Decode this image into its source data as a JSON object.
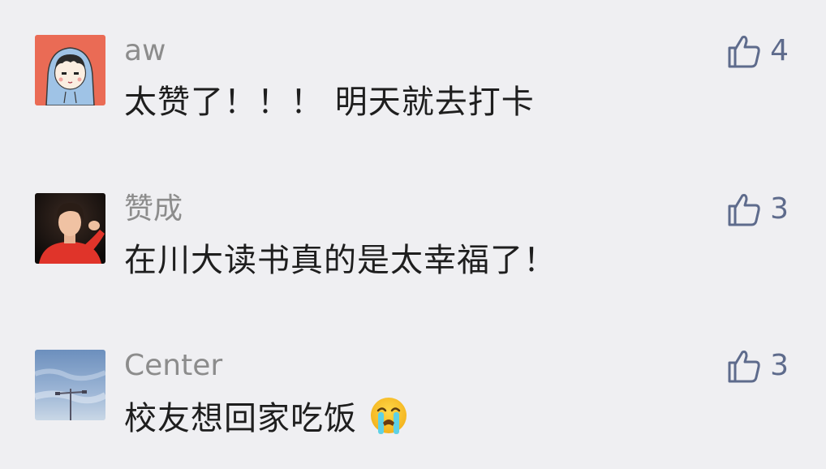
{
  "comments": [
    {
      "user": "aw",
      "text": "太赞了！！！ 明天就去打卡",
      "likes": "4",
      "avatar": "cartoon-boy-hoodie-avatar"
    },
    {
      "user": "赞成",
      "text": "在川大读书真的是太幸福了！",
      "likes": "3",
      "avatar": "person-photo-avatar"
    },
    {
      "user": "Center",
      "text": "校友想回家吃饭",
      "likes": "3",
      "avatar": "sky-streetlight-avatar",
      "emoji": "crying-face-emoji"
    }
  ],
  "colors": {
    "background": "#efeff2",
    "username": "#8c8c8c",
    "text": "#1e1e1e",
    "like": "#5e6b8c"
  }
}
